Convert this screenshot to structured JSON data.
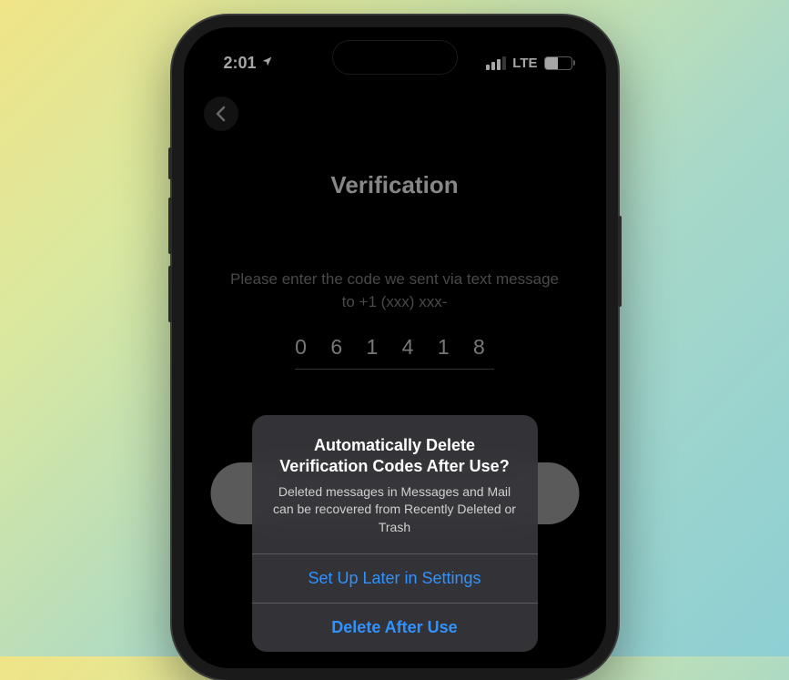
{
  "status": {
    "time": "2:01",
    "network": "LTE",
    "battery_pct": "48"
  },
  "page": {
    "title": "Verification",
    "instruction": "Please enter the code we sent via text message to +1 (xxx) xxx-",
    "code": "0 6 1 4 1 8"
  },
  "alert": {
    "title": "Automatically Delete Verification Codes After Use?",
    "body": "Deleted messages in Messages and Mail can be recovered from Recently Deleted or Trash",
    "option_later": "Set Up Later in Settings",
    "option_delete": "Delete After Use"
  }
}
